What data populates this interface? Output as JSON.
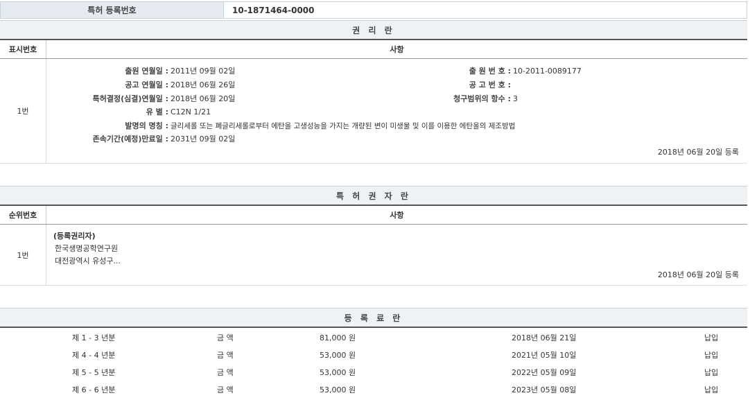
{
  "registration": {
    "label": "특허 등록번호",
    "value": "10-1871464-0000"
  },
  "rights": {
    "title": "권 리 란",
    "col_index": "표시번호",
    "col_content": "사항",
    "row_index": "1번",
    "fields": {
      "filing_date_label": "출원 연월일 :",
      "filing_date": "2011년 09월 02일",
      "pub_date_label": "공고 연월일 :",
      "pub_date": "2018년 06월 26일",
      "decision_date_label": "특허결정(심결)연월일 :",
      "decision_date": "2018년 06월 20일",
      "class_label": "유 별 :",
      "class_value": "C12N 1/21",
      "title_label": "발명의 명칭 :",
      "title_value": "글리세롤 또는 폐글리세롤로부터 에탄올 고생성능을 가지는 개량된 변이 미생물 및 이를 이용한 에탄올의 제조방법",
      "expiry_label": "존속기간(예정)만료일 :",
      "expiry_value": "2031년 09월 02일",
      "app_no_label": "출 원 번 호 :",
      "app_no": "10-2011-0089177",
      "pub_no_label": "공 고 번 호 :",
      "pub_no": "",
      "claims_label": "청구범위의 항수 :",
      "claims": "3"
    },
    "reg_date": "2018년 06월 20일 등록"
  },
  "holders": {
    "title": "특 허 권 자 란",
    "col_index": "순위번호",
    "col_content": "사항",
    "row_index": "1번",
    "line1": "(등록권리자)",
    "line2": "한국생명공학연구원",
    "line3": "대전광역시 유성구...",
    "reg_date": "2018년 06월 20일 등록"
  },
  "fees": {
    "title": "등 록 료 란",
    "rows": [
      {
        "period": "제 1 - 3 년분",
        "amount_label": "금 액",
        "amount": "81,000 원",
        "date": "2018년 06월 21일",
        "status": "납입"
      },
      {
        "period": "제 4 - 4 년분",
        "amount_label": "금 액",
        "amount": "53,000 원",
        "date": "2021년 05월 10일",
        "status": "납입"
      },
      {
        "period": "제 5 - 5 년분",
        "amount_label": "금 액",
        "amount": "53,000 원",
        "date": "2022년 05월 09일",
        "status": "납입"
      },
      {
        "period": "제 6 - 6 년분",
        "amount_label": "금 액",
        "amount": "53,000 원",
        "date": "2023년 05월 08일",
        "status": "납입"
      }
    ]
  }
}
